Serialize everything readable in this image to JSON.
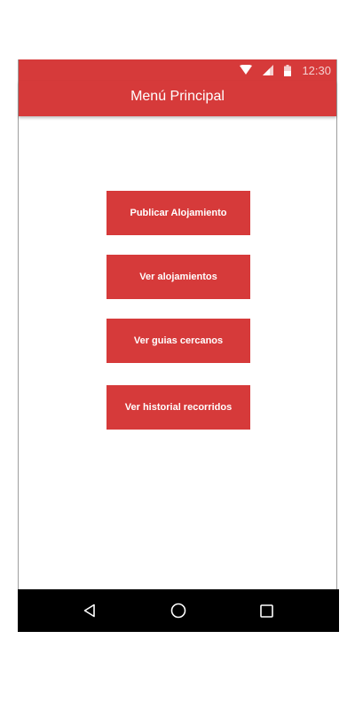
{
  "status_bar": {
    "time": "12:30",
    "icons": [
      "wifi-icon",
      "signal-icon",
      "battery-icon"
    ],
    "background": "#d63a3a"
  },
  "app_bar": {
    "title": "Menú Principal",
    "background": "#d63a3a"
  },
  "menu": {
    "buttons": [
      {
        "label": "Publicar Alojamiento"
      },
      {
        "label": "Ver alojamientos"
      },
      {
        "label": "Ver guias cercanos"
      },
      {
        "label": "Ver historial recorridos"
      }
    ],
    "button_color": "#d63a3a"
  },
  "nav_bar": {
    "icons": [
      "back-icon",
      "home-icon",
      "recents-icon"
    ],
    "background": "#000000"
  }
}
